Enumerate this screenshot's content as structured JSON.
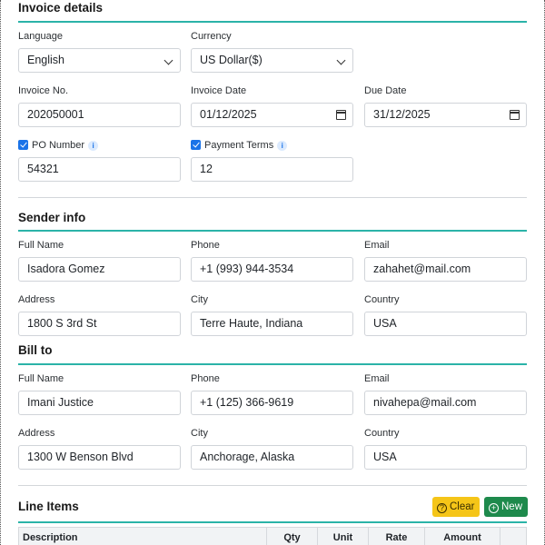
{
  "invoice_details": {
    "title": "Invoice details",
    "language": {
      "label": "Language",
      "value": "English"
    },
    "currency": {
      "label": "Currency",
      "value": "US Dollar($)"
    },
    "invoice_no": {
      "label": "Invoice No.",
      "value": "202050001"
    },
    "invoice_date": {
      "label": "Invoice Date",
      "value": "01/12/2025"
    },
    "due_date": {
      "label": "Due Date",
      "value": "31/12/2025"
    },
    "po_number": {
      "label": "PO Number",
      "value": "54321",
      "checked": true
    },
    "payment_terms": {
      "label": "Payment Terms",
      "value": "12",
      "checked": true
    }
  },
  "sender": {
    "title": "Sender info",
    "full_name": {
      "label": "Full Name",
      "value": "Isadora Gomez"
    },
    "phone": {
      "label": "Phone",
      "value": "+1 (993) 944-3534"
    },
    "email": {
      "label": "Email",
      "value": "zahahet@mail.com"
    },
    "address": {
      "label": "Address",
      "value": "1800 S 3rd St"
    },
    "city": {
      "label": "City",
      "value": "Terre Haute, Indiana"
    },
    "country": {
      "label": "Country",
      "value": "USA"
    }
  },
  "bill_to": {
    "title": "Bill to",
    "full_name": {
      "label": "Full Name",
      "value": "Imani Justice"
    },
    "phone": {
      "label": "Phone",
      "value": "+1 (125) 366-9619"
    },
    "email": {
      "label": "Email",
      "value": "nivahepa@mail.com"
    },
    "address": {
      "label": "Address",
      "value": "1300 W Benson Blvd"
    },
    "city": {
      "label": "City",
      "value": "Anchorage, Alaska"
    },
    "country": {
      "label": "Country",
      "value": "USA"
    }
  },
  "line_items": {
    "title": "Line Items",
    "clear_label": "Clear",
    "new_label": "New",
    "columns": [
      "Description",
      "Qty",
      "Unit",
      "Rate",
      "Amount"
    ]
  },
  "colors": {
    "accent": "#2bb3a8",
    "checkbox": "#1a73e8",
    "clear_button": "#f5c518",
    "new_button": "#1e8a4c"
  }
}
